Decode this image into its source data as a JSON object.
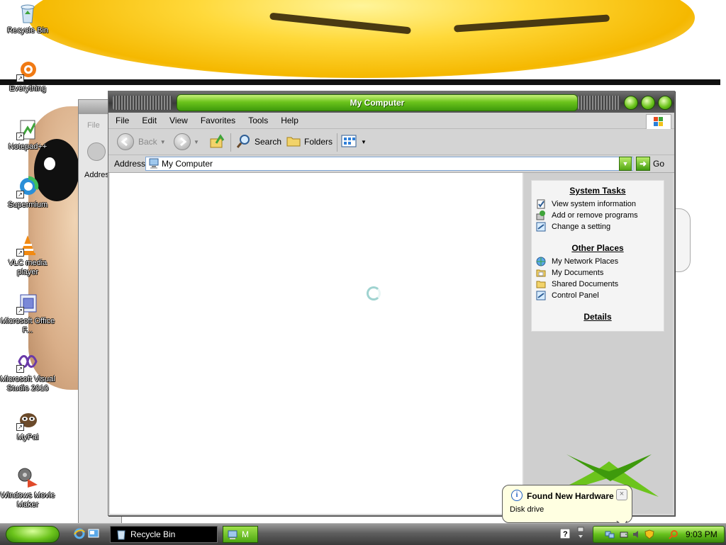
{
  "desktop": {
    "icons": [
      {
        "label": "Recycle Bin",
        "icon": "recycle-bin-icon",
        "shortcut": false
      },
      {
        "label": "Everything",
        "icon": "everything-icon",
        "shortcut": true
      },
      {
        "label": "Notepad++",
        "icon": "notepad-plus-plus-icon",
        "shortcut": true
      },
      {
        "label": "Supermium",
        "icon": "supermium-icon",
        "shortcut": true
      },
      {
        "label": "VLC media player",
        "icon": "vlc-icon",
        "shortcut": true
      },
      {
        "label": "Microsoft Office F...",
        "icon": "office-icon",
        "shortcut": true
      },
      {
        "label": "Microsoft Visual Studio 2010",
        "icon": "visual-studio-icon",
        "shortcut": true
      },
      {
        "label": "MyPal",
        "icon": "mypal-icon",
        "shortcut": true
      },
      {
        "label": "Windows Movie Maker",
        "icon": "movie-maker-icon",
        "shortcut": false
      }
    ]
  },
  "background_window": {
    "menu_first": "File",
    "address_label": "Addres"
  },
  "window": {
    "title": "My Computer",
    "menu": [
      "File",
      "Edit",
      "View",
      "Favorites",
      "Tools",
      "Help"
    ],
    "toolbar": {
      "back": "Back",
      "search": "Search",
      "folders": "Folders"
    },
    "address": {
      "label": "Address",
      "value": "My Computer",
      "go": "Go"
    }
  },
  "task_pane": {
    "system_tasks": {
      "title": "System Tasks",
      "items": [
        {
          "label": "View system information",
          "icon": "system-info-icon"
        },
        {
          "label": "Add or remove programs",
          "icon": "add-remove-programs-icon"
        },
        {
          "label": "Change a setting",
          "icon": "control-panel-icon"
        }
      ]
    },
    "other_places": {
      "title": "Other Places",
      "items": [
        {
          "label": "My Network Places",
          "icon": "network-places-icon"
        },
        {
          "label": "My Documents",
          "icon": "my-documents-icon"
        },
        {
          "label": "Shared Documents",
          "icon": "folder-icon"
        },
        {
          "label": "Control Panel",
          "icon": "control-panel-icon"
        }
      ]
    },
    "details": {
      "title": "Details"
    }
  },
  "balloon": {
    "title": "Found New Hardware",
    "text": "Disk drive"
  },
  "taskbar": {
    "buttons": [
      {
        "label": "Recycle Bin"
      },
      {
        "label": "M"
      }
    ],
    "clock": "9:03 PM"
  },
  "colors": {
    "accent_green": "#6cc41c",
    "titlebar_dark": "#3a3a3a",
    "balloon_bg": "#ffffe1"
  }
}
